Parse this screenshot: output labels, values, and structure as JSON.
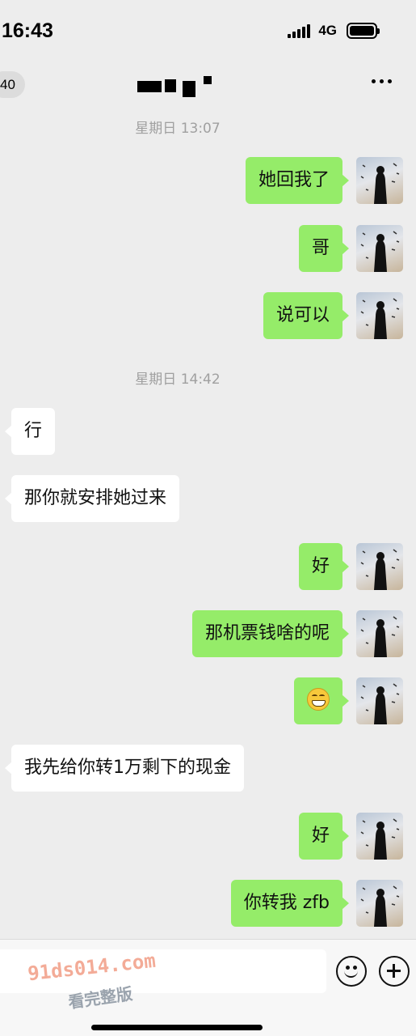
{
  "status": {
    "time": "16:43",
    "network": "4G"
  },
  "nav": {
    "back_count": "40"
  },
  "messages": [
    {
      "type": "time",
      "text": "星期日 13:07"
    },
    {
      "type": "mine",
      "text": "她回我了"
    },
    {
      "type": "mine",
      "text": "哥"
    },
    {
      "type": "mine",
      "text": "说可以"
    },
    {
      "type": "time",
      "text": "星期日 14:42"
    },
    {
      "type": "theirs",
      "text": "行"
    },
    {
      "type": "theirs",
      "text": "那你就安排她过来"
    },
    {
      "type": "mine",
      "text": "好"
    },
    {
      "type": "mine",
      "text": "那机票钱啥的呢"
    },
    {
      "type": "mine",
      "text": "",
      "emoji": "grinning-face"
    },
    {
      "type": "theirs",
      "text": "我先给你转1万剩下的现金"
    },
    {
      "type": "mine",
      "text": "好"
    },
    {
      "type": "mine",
      "text": "你转我 zfb"
    }
  ],
  "input": {
    "watermark": "91ds014.com",
    "watermark_sub": "看完整版"
  },
  "icons": {
    "emoji_button": "smiley-icon",
    "plus_button": "plus-icon",
    "more": "more-dots-icon"
  },
  "colors": {
    "mine_bubble": "#95ec69",
    "theirs_bubble": "#ffffff",
    "background": "#ededed"
  }
}
